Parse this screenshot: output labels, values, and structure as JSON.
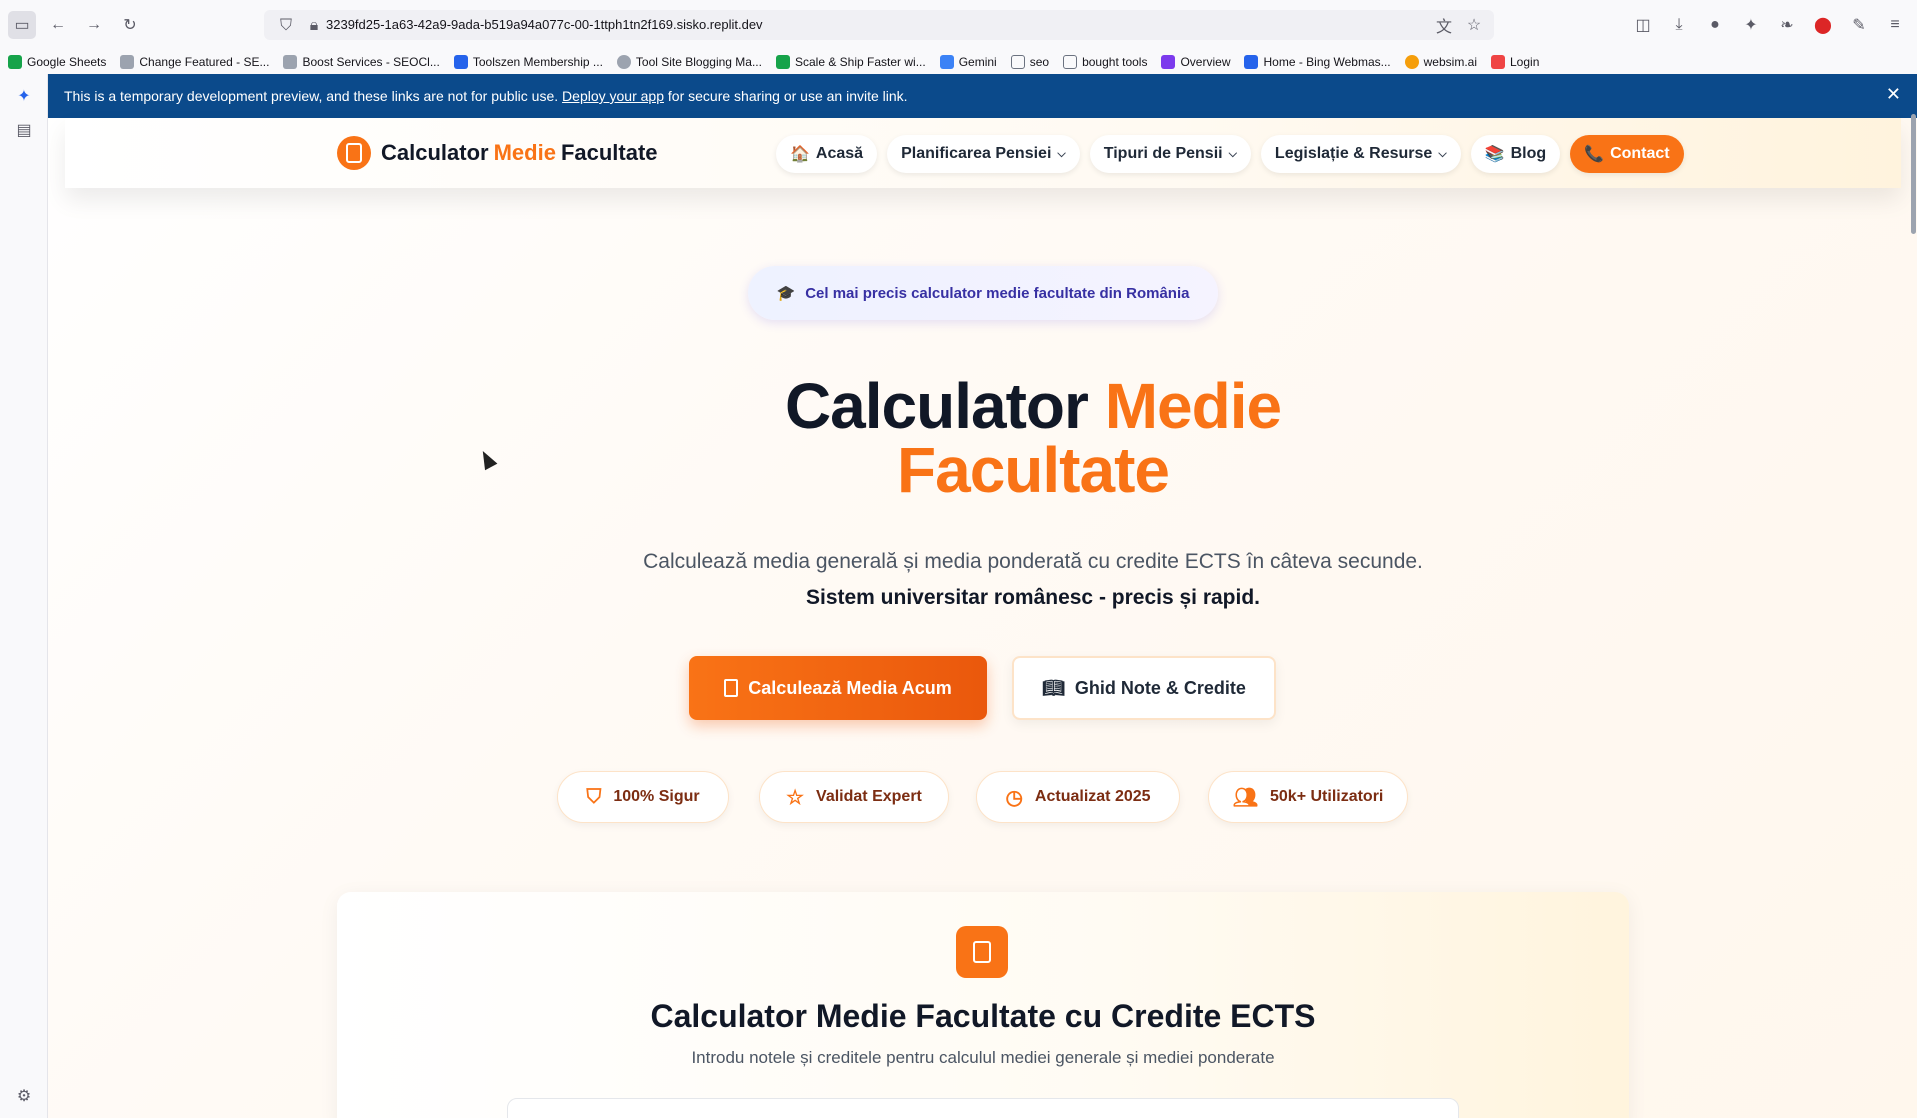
{
  "browser": {
    "url": "3239fd25-1a63-42a9-9ada-b519a94a077c-00-1ttph1tn2f169.sisko.replit.dev",
    "bookmarks": [
      {
        "label": "Google Sheets",
        "color": "#16a34a"
      },
      {
        "label": "Change Featured - SE...",
        "color": "#6b7280"
      },
      {
        "label": "Boost Services - SEOCl...",
        "color": "#6b7280"
      },
      {
        "label": "Toolszen Membership ...",
        "color": "#2563eb"
      },
      {
        "label": "Tool Site Blogging Ma...",
        "color": "#6b7280"
      },
      {
        "label": "Scale & Ship Faster wi...",
        "color": "#16a34a"
      },
      {
        "label": "Gemini",
        "color": "#3b82f6"
      },
      {
        "label": "seo",
        "color": "#6b7280"
      },
      {
        "label": "bought tools",
        "color": "#6b7280"
      },
      {
        "label": "Overview",
        "color": "#7c3aed"
      },
      {
        "label": "Home - Bing Webmas...",
        "color": "#2563eb"
      },
      {
        "label": "websim.ai",
        "color": "#f59e0b"
      },
      {
        "label": "Login",
        "color": "#ef4444"
      }
    ]
  },
  "banner": {
    "text_before": "This is a temporary development preview, and these links are not for public use.",
    "link": "Deploy your app",
    "text_after": "for secure sharing or use an invite link.",
    "close": "✕"
  },
  "header": {
    "logo_part1": "Calculator",
    "logo_part2": "Medie",
    "logo_part3": "Facultate",
    "nav": [
      {
        "label": "Acasă",
        "emoji": "🏠"
      },
      {
        "label": "Planificarea Pensiei",
        "chevron": "⌵"
      },
      {
        "label": "Tipuri de Pensii",
        "chevron": "⌵"
      },
      {
        "label": "Legislație & Resurse",
        "chevron": "⌵"
      },
      {
        "label": "Blog",
        "emoji": "📚"
      },
      {
        "label": "Contact",
        "emoji": "📞"
      }
    ]
  },
  "hero": {
    "pill_icon": "🎓",
    "pill": "Cel mai precis calculator medie facultate din România",
    "title_dark": "Calculator",
    "title_orange1": "Medie",
    "title_orange2": "Facultate",
    "subtitle": "Calculează media generală și media ponderată cu credite ECTS în câteva secunde.",
    "subtitle_bold": "Sistem universitar românesc - precis și rapid.",
    "cta_primary": "Calculează Media Acum",
    "cta_secondary": "Ghid Note & Credite",
    "badges": [
      {
        "label": "100% Sigur",
        "icon": "shield-icon"
      },
      {
        "label": "Validat Expert",
        "icon": "star-icon"
      },
      {
        "label": "Actualizat 2025",
        "icon": "clock-icon"
      },
      {
        "label": "50k+ Utilizatori",
        "icon": "users-icon"
      }
    ]
  },
  "card": {
    "title": "Calculator Medie Facultate cu Credite ECTS",
    "subtitle": "Introdu notele și creditele pentru calculul mediei generale și mediei ponderate"
  },
  "colors": {
    "accent": "#f97316",
    "banner": "#0b4a8b",
    "pill_text": "#3730a3"
  }
}
